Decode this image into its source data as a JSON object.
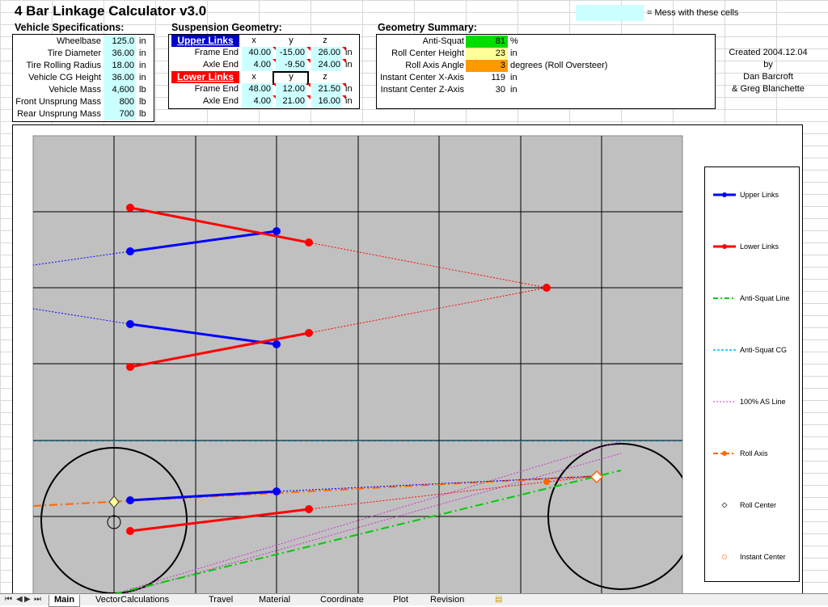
{
  "app": {
    "title": "4 Bar Linkage Calculator v3.0",
    "legend_note": "= Mess with these cells"
  },
  "vehicle": {
    "section_title": "Vehicle Specifications:",
    "rows": [
      {
        "label": "Wheelbase",
        "value": "125.0",
        "unit": "in"
      },
      {
        "label": "Tire Diameter",
        "value": "36.00",
        "unit": "in"
      },
      {
        "label": "Tire Rolling Radius",
        "value": "18.00",
        "unit": "in"
      },
      {
        "label": "Vehicle CG Height",
        "value": "36.00",
        "unit": "in"
      },
      {
        "label": "Vehicle Mass",
        "value": "4,600",
        "unit": "lb"
      },
      {
        "label": "Front Unsprung Mass",
        "value": "800",
        "unit": "lb"
      },
      {
        "label": "Rear Unsprung Mass",
        "value": "700",
        "unit": "lb"
      }
    ]
  },
  "suspension": {
    "section_title": "Suspension Geometry:",
    "upper_header": "Upper Links",
    "lower_header": "Lower Links",
    "col_x": "x",
    "col_y": "y",
    "col_z": "z",
    "upper": [
      {
        "label": "Frame End",
        "x": "40.00",
        "y": "-15.00",
        "z": "26.00",
        "unit": "in"
      },
      {
        "label": "Axle End",
        "x": "4.00",
        "y": "-9.50",
        "z": "24.00",
        "unit": "in"
      }
    ],
    "lower": [
      {
        "label": "Frame End",
        "x": "48.00",
        "y": "12.00",
        "z": "21.50",
        "unit": "in"
      },
      {
        "label": "Axle End",
        "x": "4.00",
        "y": "21.00",
        "z": "16.00",
        "unit": "in"
      }
    ]
  },
  "summary": {
    "section_title": "Geometry Summary:",
    "rows": [
      {
        "label": "Anti-Squat",
        "value": "81",
        "unit": "%",
        "color": "#00dd00"
      },
      {
        "label": "Roll Center Height",
        "value": "23",
        "unit": "in",
        "color": "#ffff99"
      },
      {
        "label": "Roll Axis Angle",
        "value": "3",
        "unit": "degrees (Roll Oversteer)",
        "color": "#ff9900"
      },
      {
        "label": "Instant Center X-Axis",
        "value": "119",
        "unit": "in",
        "color": ""
      },
      {
        "label": "Instant Center Z-Axis",
        "value": "30",
        "unit": "in",
        "color": ""
      }
    ]
  },
  "credits": {
    "line1": "Created 2004.12.04",
    "line2": "by",
    "line3": "Dan Barcroft",
    "line4": "& Greg Blanchette"
  },
  "chart_legend": [
    {
      "label": "Upper Links",
      "color": "#0000ff",
      "icon": "line-dot"
    },
    {
      "label": "Lower Links",
      "color": "#ff0000",
      "icon": "line-dot"
    },
    {
      "label": "Anti-Squat Line",
      "color": "#00cc00",
      "icon": "dash-dot"
    },
    {
      "label": "Anti-Squat CG",
      "color": "#33ccff",
      "icon": "dashed"
    },
    {
      "label": "100% AS Line",
      "color": "#cc33cc",
      "icon": "dotted"
    },
    {
      "label": "Roll Axis",
      "color": "#ff6600",
      "icon": "dash-dot"
    },
    {
      "label": "Roll Center",
      "color": "#666666",
      "icon": "diamond"
    },
    {
      "label": "Instant Center",
      "color": "#ff9966",
      "icon": "circle"
    }
  ],
  "tabs": [
    {
      "label": "Main",
      "active": true
    },
    {
      "label": "VectorCalculations",
      "active": false
    },
    {
      "label": "Travel",
      "active": false
    },
    {
      "label": "Material",
      "active": false
    },
    {
      "label": "Coordinate",
      "active": false
    },
    {
      "label": "Plot",
      "active": false
    },
    {
      "label": "Revision",
      "active": false
    }
  ],
  "colors": {
    "input_cell": "#ccffff",
    "plot_area": "#c0c0c0",
    "upper_link": "#0000ff",
    "lower_link": "#ff0000"
  }
}
